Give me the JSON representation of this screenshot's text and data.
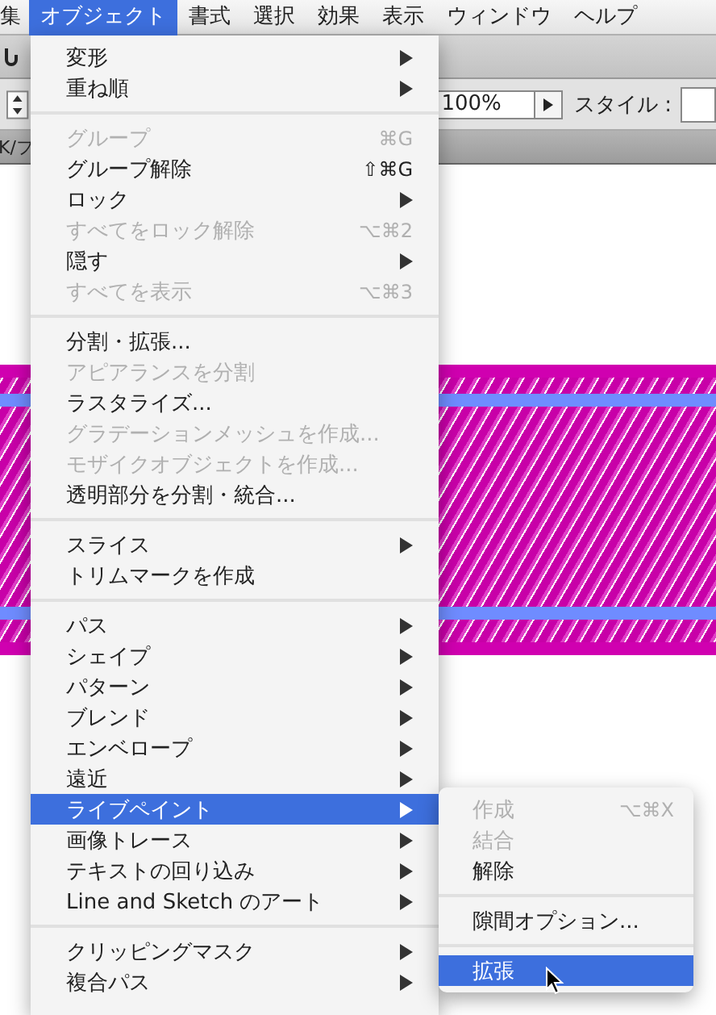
{
  "menu_bar": [
    {
      "label": "集",
      "selected": false
    },
    {
      "label": "オブジェクト",
      "selected": true
    },
    {
      "label": "書式",
      "selected": false
    },
    {
      "label": "選択",
      "selected": false
    },
    {
      "label": "効果",
      "selected": false
    },
    {
      "label": "表示",
      "selected": false
    },
    {
      "label": "ウィンドウ",
      "selected": false
    },
    {
      "label": "ヘルプ",
      "selected": false
    }
  ],
  "control_bar": {
    "zoom_value": "100%",
    "style_label": "スタイル :",
    "tab_label": "K/フ"
  },
  "menu": {
    "sections": [
      {
        "items": [
          {
            "label": "変形",
            "has_submenu": true,
            "disabled": false,
            "selected": false
          },
          {
            "label": "重ね順",
            "has_submenu": true,
            "disabled": false,
            "selected": false
          }
        ]
      },
      {
        "items": [
          {
            "label": "グループ",
            "shortcut": "⌘G",
            "has_submenu": false,
            "disabled": true,
            "selected": false
          },
          {
            "label": "グループ解除",
            "shortcut": "⇧⌘G",
            "has_submenu": false,
            "disabled": false,
            "selected": false
          },
          {
            "label": "ロック",
            "has_submenu": true,
            "disabled": false,
            "selected": false
          },
          {
            "label": "すべてをロック解除",
            "shortcut": "⌥⌘2",
            "has_submenu": false,
            "disabled": true,
            "selected": false
          },
          {
            "label": "隠す",
            "has_submenu": true,
            "disabled": false,
            "selected": false
          },
          {
            "label": "すべてを表示",
            "shortcut": "⌥⌘3",
            "has_submenu": false,
            "disabled": true,
            "selected": false
          }
        ]
      },
      {
        "items": [
          {
            "label": "分割・拡張...",
            "has_submenu": false,
            "disabled": false,
            "selected": false
          },
          {
            "label": "アピアランスを分割",
            "has_submenu": false,
            "disabled": true,
            "selected": false
          },
          {
            "label": "ラスタライズ...",
            "has_submenu": false,
            "disabled": false,
            "selected": false
          },
          {
            "label": "グラデーションメッシュを作成...",
            "has_submenu": false,
            "disabled": true,
            "selected": false
          },
          {
            "label": "モザイクオブジェクトを作成...",
            "has_submenu": false,
            "disabled": true,
            "selected": false
          },
          {
            "label": "透明部分を分割・統合...",
            "has_submenu": false,
            "disabled": false,
            "selected": false
          }
        ]
      },
      {
        "items": [
          {
            "label": "スライス",
            "has_submenu": true,
            "disabled": false,
            "selected": false
          },
          {
            "label": "トリムマークを作成",
            "has_submenu": false,
            "disabled": false,
            "selected": false
          }
        ]
      },
      {
        "items": [
          {
            "label": "パス",
            "has_submenu": true,
            "disabled": false,
            "selected": false
          },
          {
            "label": "シェイプ",
            "has_submenu": true,
            "disabled": false,
            "selected": false
          },
          {
            "label": "パターン",
            "has_submenu": true,
            "disabled": false,
            "selected": false
          },
          {
            "label": "ブレンド",
            "has_submenu": true,
            "disabled": false,
            "selected": false
          },
          {
            "label": "エンベロープ",
            "has_submenu": true,
            "disabled": false,
            "selected": false
          },
          {
            "label": "遠近",
            "has_submenu": true,
            "disabled": false,
            "selected": false
          },
          {
            "label": "ライブペイント",
            "has_submenu": true,
            "disabled": false,
            "selected": true
          },
          {
            "label": "画像トレース",
            "has_submenu": true,
            "disabled": false,
            "selected": false
          },
          {
            "label": "テキストの回り込み",
            "has_submenu": true,
            "disabled": false,
            "selected": false
          },
          {
            "label": "Line and Sketch のアート",
            "has_submenu": true,
            "disabled": false,
            "selected": false
          }
        ]
      },
      {
        "items": [
          {
            "label": "クリッピングマスク",
            "has_submenu": true,
            "disabled": false,
            "selected": false
          },
          {
            "label": "複合パス",
            "has_submenu": true,
            "disabled": false,
            "selected": false
          }
        ]
      }
    ]
  },
  "submenu": {
    "sections": [
      {
        "items": [
          {
            "label": "作成",
            "shortcut": "⌥⌘X",
            "disabled": true,
            "selected": false
          },
          {
            "label": "結合",
            "disabled": true,
            "selected": false
          },
          {
            "label": "解除",
            "disabled": false,
            "selected": false
          }
        ]
      },
      {
        "items": [
          {
            "label": "隙間オプション...",
            "disabled": false,
            "selected": false
          }
        ]
      },
      {
        "items": [
          {
            "label": "拡張",
            "disabled": false,
            "selected": true
          }
        ]
      }
    ]
  }
}
